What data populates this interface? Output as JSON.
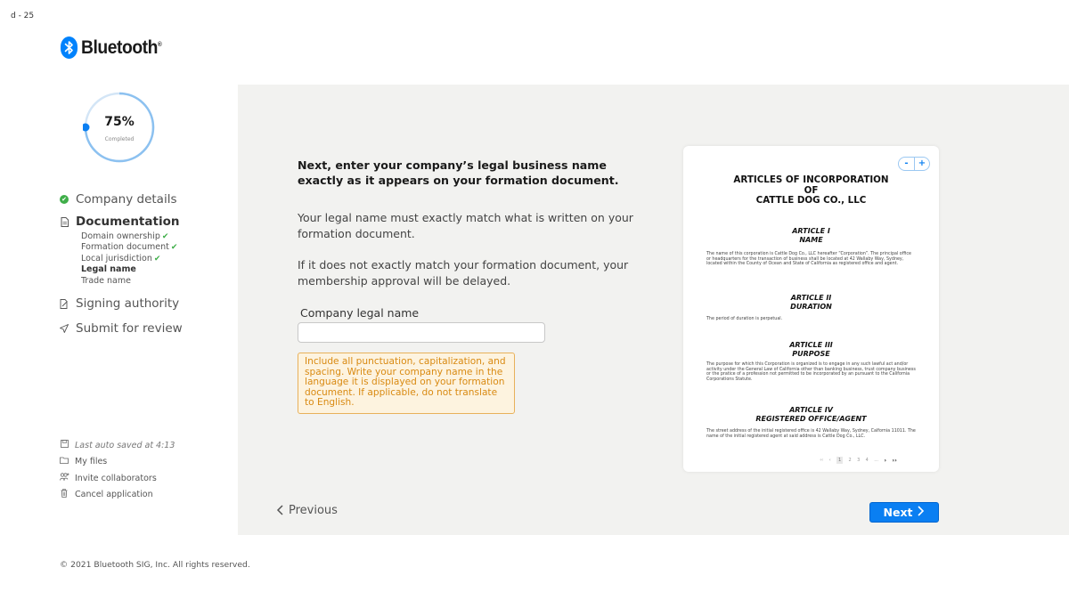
{
  "page_id": "d - 25",
  "brand": {
    "name": "Bluetooth",
    "reg": "®",
    "color": "#0082fc"
  },
  "progress": {
    "percent_label": "75%",
    "sub_label": "Completed",
    "value": 0.75
  },
  "steps": [
    {
      "label": "Company details",
      "state": "done",
      "icon": "check-circle-icon"
    },
    {
      "label": "Documentation",
      "state": "active",
      "icon": "document-icon",
      "substeps": [
        {
          "label": "Domain ownership",
          "done": true
        },
        {
          "label": "Formation document",
          "done": true
        },
        {
          "label": "Local jurisdiction",
          "done": true
        },
        {
          "label": "Legal name",
          "current": true
        },
        {
          "label": "Trade name"
        }
      ]
    },
    {
      "label": "Signing authority",
      "state": "pending",
      "icon": "signature-icon"
    },
    {
      "label": "Submit for review",
      "state": "pending",
      "icon": "send-icon"
    }
  ],
  "check_glyph": "✔",
  "utilities": {
    "saved": "Last auto saved at 4:13",
    "files": "My files",
    "invite": "Invite collaborators",
    "cancel": "Cancel application"
  },
  "main": {
    "heading": "Next, enter your company’s legal business name exactly as it appears on your formation document.",
    "para1": "Your legal name must exactly match what is written on your formation document.",
    "para2": "If it does not exactly match your formation document, your membership approval will be delayed.",
    "field_label": "Company legal name",
    "field_value": "",
    "hint": "Include all punctuation, capitalization, and spacing. Write your company name in the language it is displayed on your formation document. If applicable, do not translate to English.",
    "prev_label": "Previous",
    "next_label": "Next"
  },
  "document": {
    "zoom_out": "-",
    "zoom_in": "+",
    "title_line1": "ARTICLES OF INCORPORATION",
    "title_line2": "OF",
    "title_line3": "CATTLE DOG CO., LLC",
    "articles": [
      {
        "heading": "ARTICLE I",
        "sub": "NAME",
        "body": "The name of this corporation is Cattle Dog Co., LLC hereafter “Corporation”. The principal office or headquarters for the transaction of business shall be located at 42 Wallaby Way, Sydney, located within the County of Ocean and State of California as registered office and agent."
      },
      {
        "heading": "ARTICLE II",
        "sub": "DURATION",
        "body": "The period of duration is perpetual."
      },
      {
        "heading": "ARTICLE III",
        "sub": "PURPOSE",
        "body": "The purpose for which this Corporation is organized is to engage in any such lawful act and/or activity under the General Law of California other than banking business, trust company business or the pratice of a profession not permitted to be incorporated by an pursuant to the California Corporations Statute."
      },
      {
        "heading": "ARTICLE IV",
        "sub": "REGISTERED OFFICE/AGENT",
        "body": "The street address of the initial registered office is 42 Wallaby Way, Sydney, Calfornia 11011. The name of the initial registered agent at said address is Cattle Dog Co., LLC."
      }
    ],
    "pager": {
      "first": "‹‹",
      "prev": "‹",
      "pages": [
        "1",
        "2",
        "3",
        "4"
      ],
      "current": "1",
      "ellipsis": "...",
      "next": "›",
      "last": "››"
    }
  },
  "footer": "© 2021 Bluetooth SIG, Inc. All rights reserved."
}
